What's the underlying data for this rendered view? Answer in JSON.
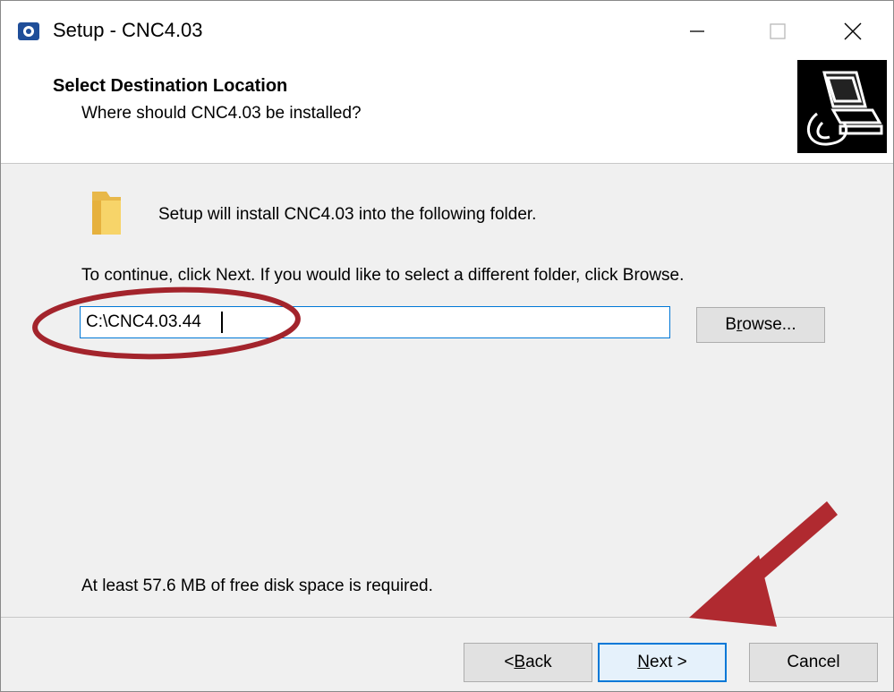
{
  "window": {
    "title": "Setup - CNC4.03",
    "minimize_icon": "minimize-icon",
    "maximize_icon": "maximize-icon",
    "close_icon": "close-icon"
  },
  "header": {
    "title": "Select Destination Location",
    "subtitle": "Where should CNC4.03 be installed?",
    "image_icon": "computer-install-icon"
  },
  "content": {
    "folder_icon": "folder-icon",
    "install_text": "Setup will install CNC4.03 into the following folder.",
    "continue_text": "To continue, click Next. If you would like to select a different folder, click Browse.",
    "path_value": "C:\\CNC4.03.44",
    "browse_pre": "B",
    "browse_acc": "r",
    "browse_post": "owse...",
    "space_text": "At least 57.6 MB of free disk space is required."
  },
  "footer": {
    "back_pre": "< ",
    "back_acc": "B",
    "back_post": "ack",
    "next_pre": "",
    "next_acc": "N",
    "next_post": "ext >",
    "cancel_label": "Cancel"
  },
  "annotations": {
    "highlight_color": "#a3242c",
    "arrow_color": "#b02a30"
  }
}
